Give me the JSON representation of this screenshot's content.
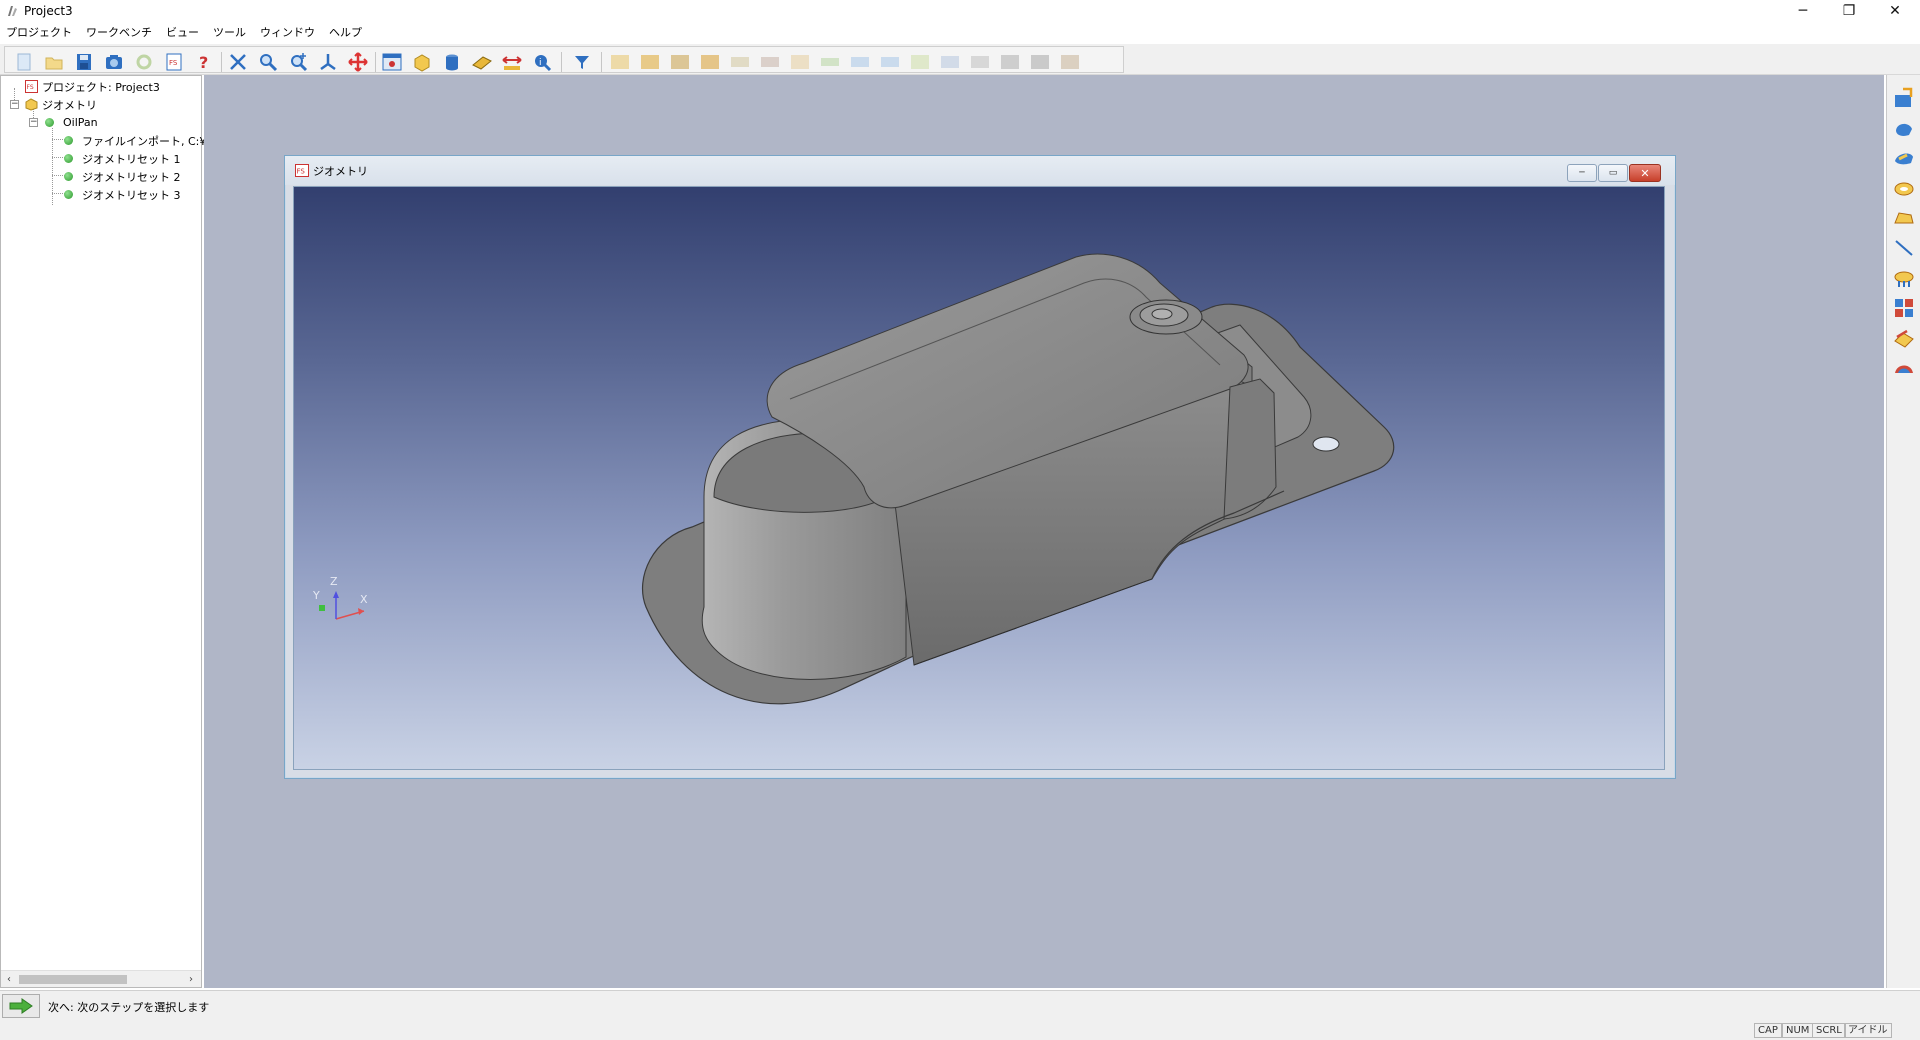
{
  "window": {
    "title": "Project3",
    "icon": "fs-app-icon",
    "minimize": "─",
    "maximize": "❐",
    "close": "✕"
  },
  "menu": [
    "プロジェクト",
    "ワークベンチ",
    "ビュー",
    "ツール",
    "ウィンドウ",
    "ヘルプ"
  ],
  "toolbar": {
    "icons": [
      "new-icon",
      "open-icon",
      "save-icon",
      "snapshot-icon",
      "refresh-icon",
      "fs-report-icon",
      "help-icon",
      "fit-all-icon",
      "zoom-icon",
      "zoom-window-icon",
      "rotate-icon",
      "pan-icon",
      "view-settings-icon",
      "shaded-box-icon",
      "shaded-cylinder-icon",
      "section-plane-icon",
      "measure-icon",
      "query-icon",
      "filter-icon",
      "geometry-tool-icons"
    ]
  },
  "tree": {
    "project": "プロジェクト: Project3",
    "geometry": "ジオメトリ",
    "part": "OilPan",
    "children": [
      "ファイルインポート, C:¥FT",
      "ジオメトリセット 1",
      "ジオメトリセット 2",
      "ジオメトリセット 3"
    ]
  },
  "child_window": {
    "title": "ジオメトリ",
    "icon": "fs-doc-icon",
    "minimize": "─",
    "maximize": "▭",
    "close": "✕",
    "model_name": "OilPan",
    "colors": {
      "bg_top": "#323f6f",
      "bg_bottom": "#c9d2e5",
      "model": "#8a8a8a"
    }
  },
  "axis": {
    "x": "X",
    "y": "Y",
    "z": "Z",
    "colors": {
      "x": "#e05050",
      "y": "#3fbf3f",
      "z": "#5050e0"
    }
  },
  "right_panel": {
    "icons": [
      "add-geometry-icon",
      "surface-icon",
      "face-group-icon",
      "loop-icon",
      "edge-loop-icon",
      "line-icon",
      "fill-hole-icon",
      "pattern-icon",
      "transfer-icon",
      "thickness-icon"
    ]
  },
  "status": {
    "next_icon": "arrow-right-icon",
    "message": "次へ: 次のステップを選択します",
    "indicators": [
      "CAP",
      "NUM",
      "SCRL",
      "アイドル"
    ]
  }
}
